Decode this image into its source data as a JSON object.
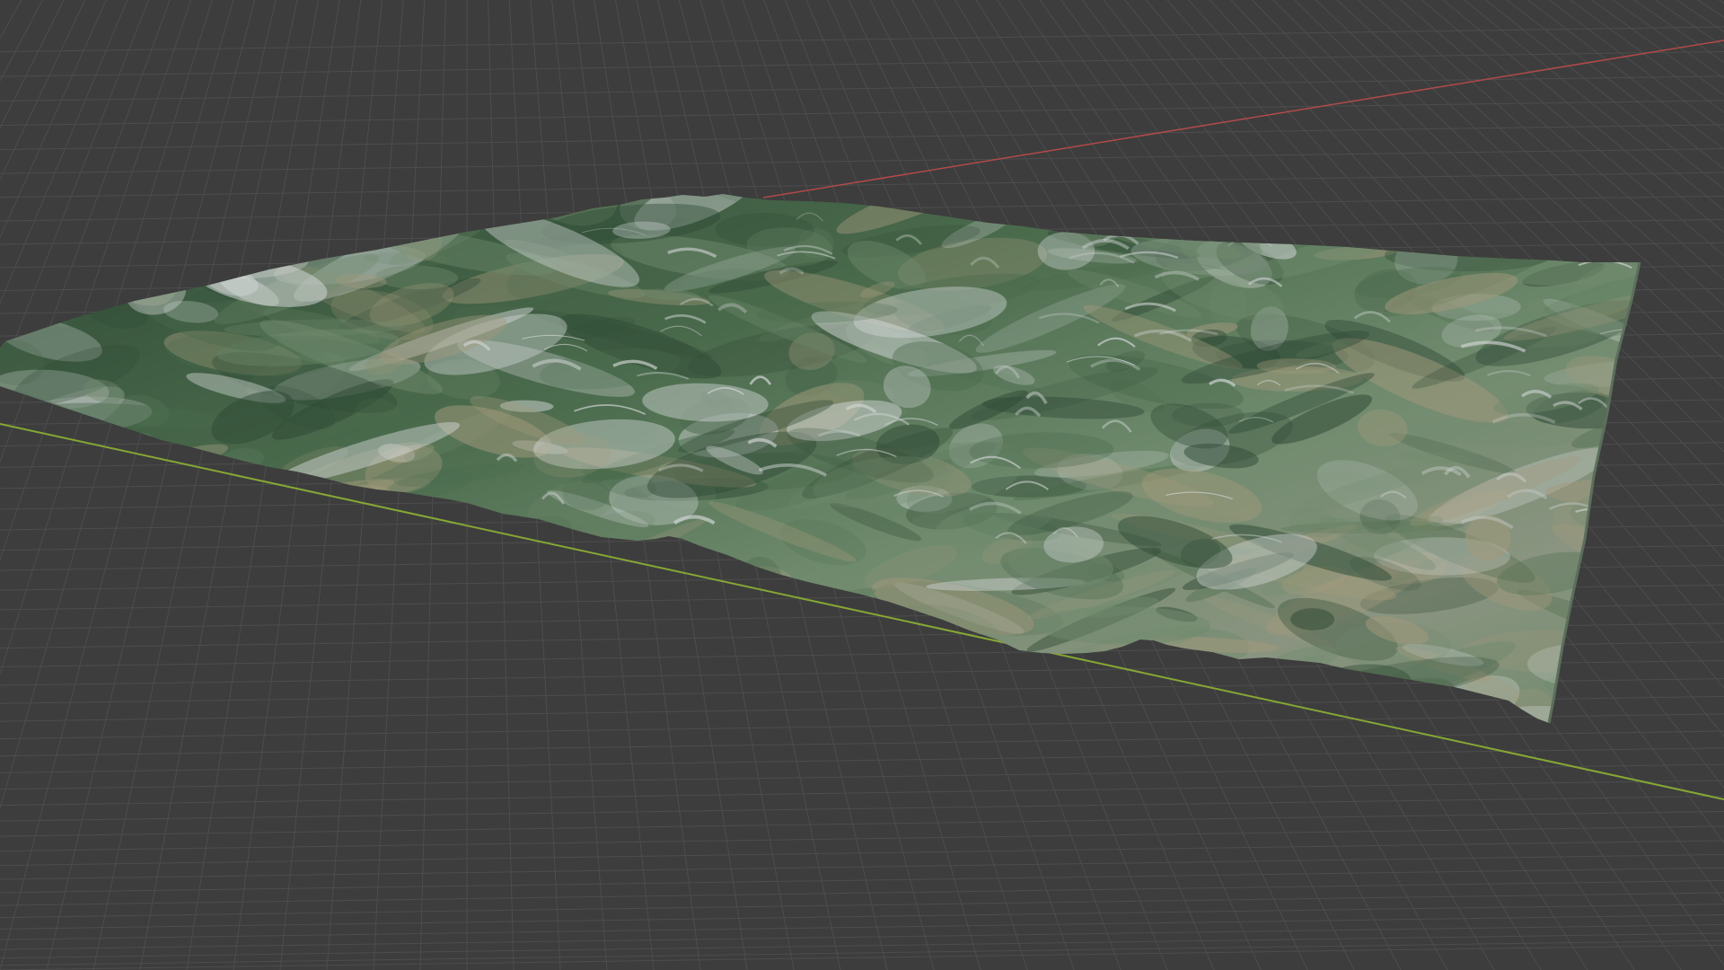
{
  "viewport": {
    "name": "3d-viewport",
    "background_color": "#3d3d3d",
    "grid_line_color": "#4d4d4d",
    "x_axis_color": "#b24a4a",
    "y_axis_color": "#86a735"
  },
  "terrain": {
    "name": "terrain-mesh",
    "palette": [
      "#2f4a35",
      "#4a6a4c",
      "#6f8a6d",
      "#a39a7c",
      "#d4d8d8"
    ]
  }
}
